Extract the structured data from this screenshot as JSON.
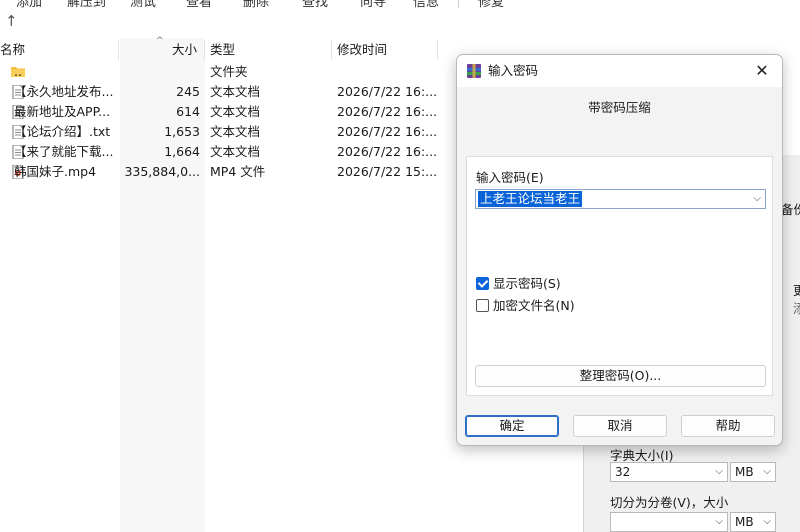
{
  "toolbar": {
    "items": [
      "添加",
      "解压到",
      "测试",
      "查看",
      "删除",
      "查找",
      "向导",
      "信息",
      "修复"
    ]
  },
  "list": {
    "headers": {
      "name": "名称",
      "size": "大小",
      "type": "类型",
      "date": "修改时间"
    },
    "rows": [
      {
        "icon": "folder-icon",
        "name": "..",
        "size": "",
        "type": "文件夹",
        "date": ""
      },
      {
        "icon": "text-file-icon",
        "name": "【永久地址发布...",
        "size": "245",
        "type": "文本文档",
        "date": "2026/7/22 16:..."
      },
      {
        "icon": "text-file-icon",
        "name": "最新地址及APP...",
        "size": "614",
        "type": "文本文档",
        "date": "2026/7/22 16:..."
      },
      {
        "icon": "text-file-icon",
        "name": "【论坛介绍】.txt",
        "size": "1,653",
        "type": "文本文档",
        "date": "2026/7/22 16:..."
      },
      {
        "icon": "text-file-icon",
        "name": "【来了就能下载...",
        "size": "1,664",
        "type": "文本文档",
        "date": "2026/7/22 16:..."
      },
      {
        "icon": "video-file-icon",
        "name": "韩国妹子.mp4",
        "size": "335,884,0...",
        "type": "MP4 文件",
        "date": "2026/7/22 15:..."
      }
    ]
  },
  "background_dialog": {
    "partial_text_1": "备份",
    "partial_text_2": "更",
    "partial_text_3": "添",
    "dict_label": "字典大小(I)",
    "dict_value": "32",
    "dict_unit": "MB",
    "split_label": "切分为分卷(V)，大小",
    "split_value": "",
    "split_unit": "MB"
  },
  "dialog": {
    "title": "输入密码",
    "close_symbol": "✕",
    "subtitle": "带密码压缩",
    "password_label": "输入密码(E)",
    "password_value": "上老王论坛当老王",
    "show_password_label": "显示密码(S)",
    "show_password_checked": true,
    "encrypt_names_label": "加密文件名(N)",
    "encrypt_names_checked": false,
    "organize_button": "整理密码(O)...",
    "ok_button": "确定",
    "cancel_button": "取消",
    "help_button": "帮助"
  },
  "colors": {
    "accent": "#0a64d8",
    "folder": "#f2c045"
  }
}
